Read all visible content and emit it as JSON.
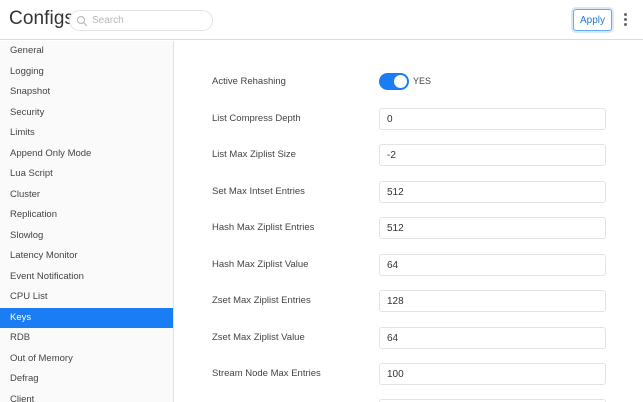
{
  "header": {
    "title": "Configs",
    "search_placeholder": "Search",
    "apply_label": "Apply"
  },
  "sidebar": {
    "items": [
      {
        "label": "General"
      },
      {
        "label": "Logging"
      },
      {
        "label": "Snapshot"
      },
      {
        "label": "Security"
      },
      {
        "label": "Limits"
      },
      {
        "label": "Append Only Mode"
      },
      {
        "label": "Lua Script"
      },
      {
        "label": "Cluster"
      },
      {
        "label": "Replication"
      },
      {
        "label": "Slowlog"
      },
      {
        "label": "Latency Monitor"
      },
      {
        "label": "Event Notification"
      },
      {
        "label": "CPU List"
      },
      {
        "label": "Keys"
      },
      {
        "label": "RDB"
      },
      {
        "label": "Out of Memory"
      },
      {
        "label": "Defrag"
      },
      {
        "label": "Client"
      }
    ],
    "active": "Keys"
  },
  "settings": {
    "active_rehashing": {
      "label": "Active Rehashing",
      "state": "YES"
    },
    "fields": [
      {
        "label": "List Compress Depth",
        "value": "0"
      },
      {
        "label": "List Max Ziplist Size",
        "value": "-2"
      },
      {
        "label": "Set Max Intset Entries",
        "value": "512"
      },
      {
        "label": "Hash Max Ziplist Entries",
        "value": "512"
      },
      {
        "label": "Hash Max Ziplist Value",
        "value": "64"
      },
      {
        "label": "Zset Max Ziplist Entries",
        "value": "128"
      },
      {
        "label": "Zset Max Ziplist Value",
        "value": "64"
      },
      {
        "label": "Stream Node Max Entries",
        "value": "100"
      }
    ]
  },
  "colors": {
    "accent": "#1a7df3",
    "apply_border": "#64a9f2"
  }
}
